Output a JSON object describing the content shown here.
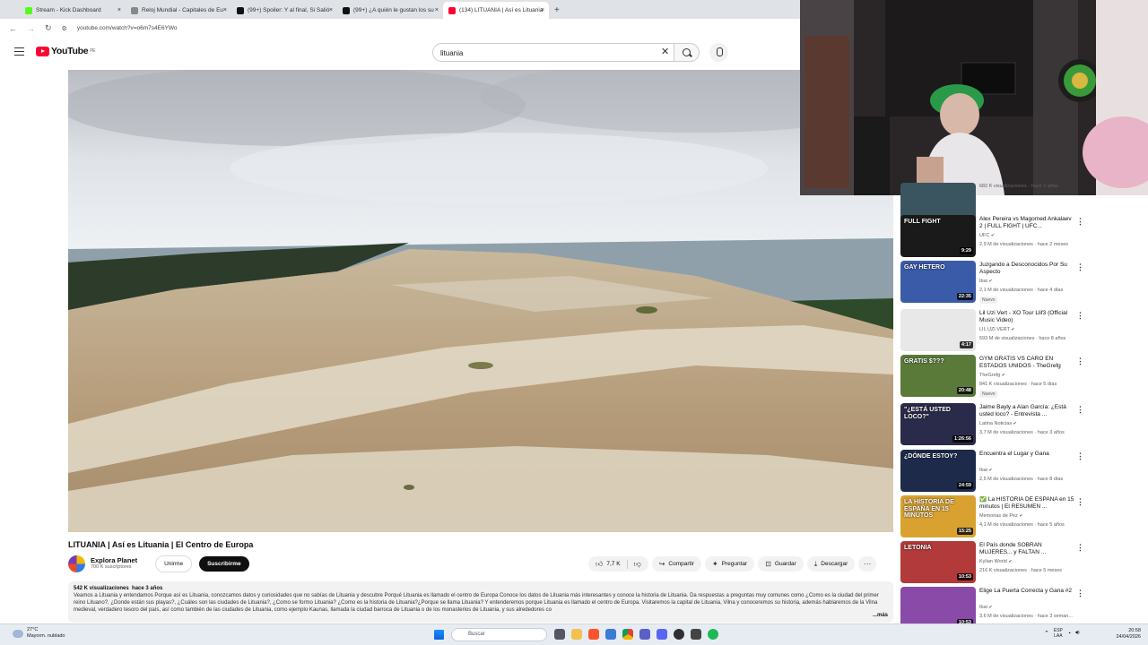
{
  "browser": {
    "tabs": [
      {
        "label": "Stream - Kick Dashboard",
        "color": "#53fc18"
      },
      {
        "label": "Reloj Mundial - Capitales de Eu",
        "color": "#888888"
      },
      {
        "label": "(99+) Spoiler: Y al final, Si Salió",
        "color": "#111111"
      },
      {
        "label": "(99+) ¿A quién le gustan los su",
        "color": "#111111"
      },
      {
        "label": "(134) LITUANIA | Así es Lituania",
        "color": "#ff0033"
      }
    ],
    "close_glyph": "×",
    "new_tab_glyph": "+",
    "url": "youtube.com/watch?v=o6m7s4E6YWo"
  },
  "youtube": {
    "logo_text": "YouTube",
    "logo_region": "PE",
    "search_value": "lituania",
    "video": {
      "title": "LITUANIA | Así es Lituania | El Centro de Europa",
      "channel": "Explora Planet",
      "subscribers": "700 K suscriptores",
      "join_label": "Unirme",
      "subscribe_label": "Suscribirme",
      "likes": "7,7 K",
      "share_label": "Compartir",
      "ask_label": "Preguntar",
      "save_label": "Guardar",
      "download_label": "Descargar",
      "views": "542 K visualizaciones",
      "age": "hace 3 años",
      "description": "Veamos a Lituania y entendamos Porque así es Lituania, conozcamos datos y curiosidades que no sabías de Lituania y descubre Porqué Lituania es llamado el centro de Europa Conoce los datos de Lituania más interesantes y conoce la historia de Lituania. Da respuestas a preguntas muy comunes como ¿Como es la ciudad del primer reino Lituano?, ¿Donde están sus playas?, ¿Cuáles son las ciudades de Lituania?, ¿Como se formo Lituania? ¿Como es la historia de Lituania?¿Porque se llama Lituania? Y entenderemos porque Lituania es llamado el centro de Europa. Visitaremos la capital de Lituania, Vilna y conoceremos su historia, además hablaremos de la Vilna medieval, verdadero tesoro del país, así como también de las ciudades de Lituania, como ejemplo Kaunas, llamada la ciudad barroca de Lituania o de los monasterios de Lituania, y sus alrededores co",
      "more_label": "...más"
    },
    "recommendations": [
      {
        "title": "",
        "channel": "",
        "meta": "682 K visualizaciones · hace 2 años",
        "duration": "9:49",
        "badge": "",
        "thumb": "#3b5560"
      },
      {
        "title": "Alex Pereira vs Magomed Ankalaev 2 | FULL FIGHT | UFC...",
        "channel": "UFC",
        "meta": "2,9 M de visualizaciones · hace 2 meses",
        "duration": "9:29",
        "badge": "",
        "thumb": "#1a1a1a",
        "thumb_text": "FULL FIGHT"
      },
      {
        "title": "Juzgando a Desconocidos Por Su Aspecto",
        "channel": "Ibai",
        "meta": "2,1 M de visualizaciones · hace 4 días",
        "duration": "22:35",
        "badge": "Nuevo",
        "thumb": "#3a5ca8",
        "thumb_text": "GAY  HETERO"
      },
      {
        "title": "Lil Uzi Vert - XO Tour Llif3 (Official Music Video)",
        "channel": "LIL UZI VERT",
        "meta": "593 M de visualizaciones · hace 8 años",
        "duration": "4:17",
        "badge": "",
        "thumb": "#e8e8e8"
      },
      {
        "title": "GYM GRATIS VS CARO EN ESTADOS UNIDOS - TheGrefg",
        "channel": "TheGrefg",
        "meta": "841 K visualizaciones · hace 5 días",
        "duration": "20:48",
        "badge": "Nuevo",
        "thumb": "#5a7a3a",
        "thumb_text": "GRATIS  $???"
      },
      {
        "title": "Jaime Bayly a Alan García: ¿Está usted loco? - Entrevista ...",
        "channel": "Latina Noticias",
        "meta": "3,7 M de visualizaciones · hace 3 años",
        "duration": "1:26:56",
        "badge": "",
        "thumb": "#2a2a4a",
        "thumb_text": "\"¿ESTÁ USTED LOCO?\""
      },
      {
        "title": "Encuentra el Lugar y Gana",
        "channel": "Ibai",
        "meta": "2,5 M de visualizaciones · hace 8 días",
        "duration": "24:59",
        "badge": "",
        "thumb": "#1d2a4a",
        "thumb_text": "¿DÓNDE ESTOY?"
      },
      {
        "title": "✅ La HISTORIA DE ESPAÑA en 15 minutos | El RESUMEN ...",
        "channel": "Memorias de Pez",
        "meta": "4,1 M de visualizaciones · hace 5 años",
        "duration": "15:25",
        "badge": "",
        "thumb": "#d9a230",
        "thumb_text": "LA HISTORIA DE ESPAÑA EN 15 MINUTOS"
      },
      {
        "title": "El País donde SOBRAN MUJERES... y FALTAN ...",
        "channel": "Kylian World",
        "meta": "216 K visualizaciones · hace 5 meses",
        "duration": "10:53",
        "badge": "",
        "thumb": "#b23a3a",
        "thumb_text": "LETONIA"
      },
      {
        "title": "Elige La Puerta Correcta y Gana #2",
        "channel": "Ibai",
        "meta": "3,6 M de visualizaciones · hace 3 seman...",
        "duration": "10:53",
        "badge": "",
        "thumb": "#8a4aa8"
      }
    ],
    "verified_glyph": "✔",
    "kebab_glyph": "⋮"
  },
  "taskbar": {
    "temp": "27°C",
    "weather": "Mayorm. nublado",
    "search_placeholder": "Buscar",
    "lang_top": "ESP",
    "lang_bottom": "LAA",
    "time": "20:58",
    "date": "24/04/2026"
  },
  "colors": {
    "yt_red": "#ff0033",
    "accent_blue": "#065fd4"
  }
}
